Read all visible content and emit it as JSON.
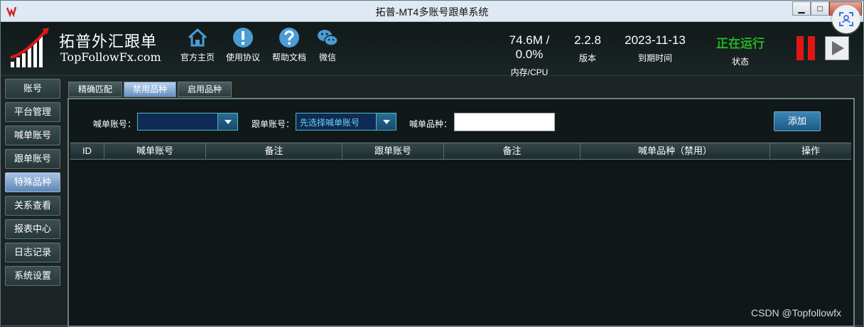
{
  "window": {
    "title": "拓普-MT4多账号跟单系统",
    "minimize": "▁",
    "maximize": "□",
    "close": "X"
  },
  "brand": {
    "name_cn": "拓普外汇跟单",
    "name_en": "TopFollowFx.com"
  },
  "nav": [
    {
      "label": "官方主页",
      "icon": "home-icon"
    },
    {
      "label": "使用协议",
      "icon": "alert-icon"
    },
    {
      "label": "帮助文档",
      "icon": "help-icon"
    },
    {
      "label": "微信",
      "icon": "wechat-icon"
    }
  ],
  "status": {
    "memory_cpu_value": "74.6M / 0.0%",
    "memory_cpu_label": "内存/CPU",
    "version_value": "2.2.8",
    "version_label": "版本",
    "expiry_value": "2023-11-13",
    "expiry_label": "到期时间",
    "state_value": "正在运行",
    "state_label": "状态",
    "state_color": "#22b322"
  },
  "sidebar": {
    "items": [
      {
        "label": "账号"
      },
      {
        "label": "平台管理"
      },
      {
        "label": "喊单账号"
      },
      {
        "label": "跟单账号"
      },
      {
        "label": "特殊品种",
        "active": true
      },
      {
        "label": "关系查看"
      },
      {
        "label": "报表中心"
      },
      {
        "label": "日志记录"
      },
      {
        "label": "系统设置"
      }
    ]
  },
  "tabs": [
    {
      "label": "精确匹配"
    },
    {
      "label": "禁用品种",
      "active": true
    },
    {
      "label": "启用品种"
    }
  ],
  "form": {
    "shout_account_label": "喊单账号：",
    "shout_account_value": "",
    "follow_account_label": "跟单账号：",
    "follow_account_value": "先选择喊单账号",
    "symbol_label": "喊单品种：",
    "symbol_value": "",
    "add_button": "添加"
  },
  "table": {
    "columns": [
      "ID",
      "喊单账号",
      "备注",
      "跟单账号",
      "备注",
      "喊单品种（禁用）",
      "操作"
    ],
    "rows": []
  },
  "watermark": "CSDN @Topfollowfx",
  "colors": {
    "pause": "#e01616",
    "accent": "#5f86b6"
  }
}
